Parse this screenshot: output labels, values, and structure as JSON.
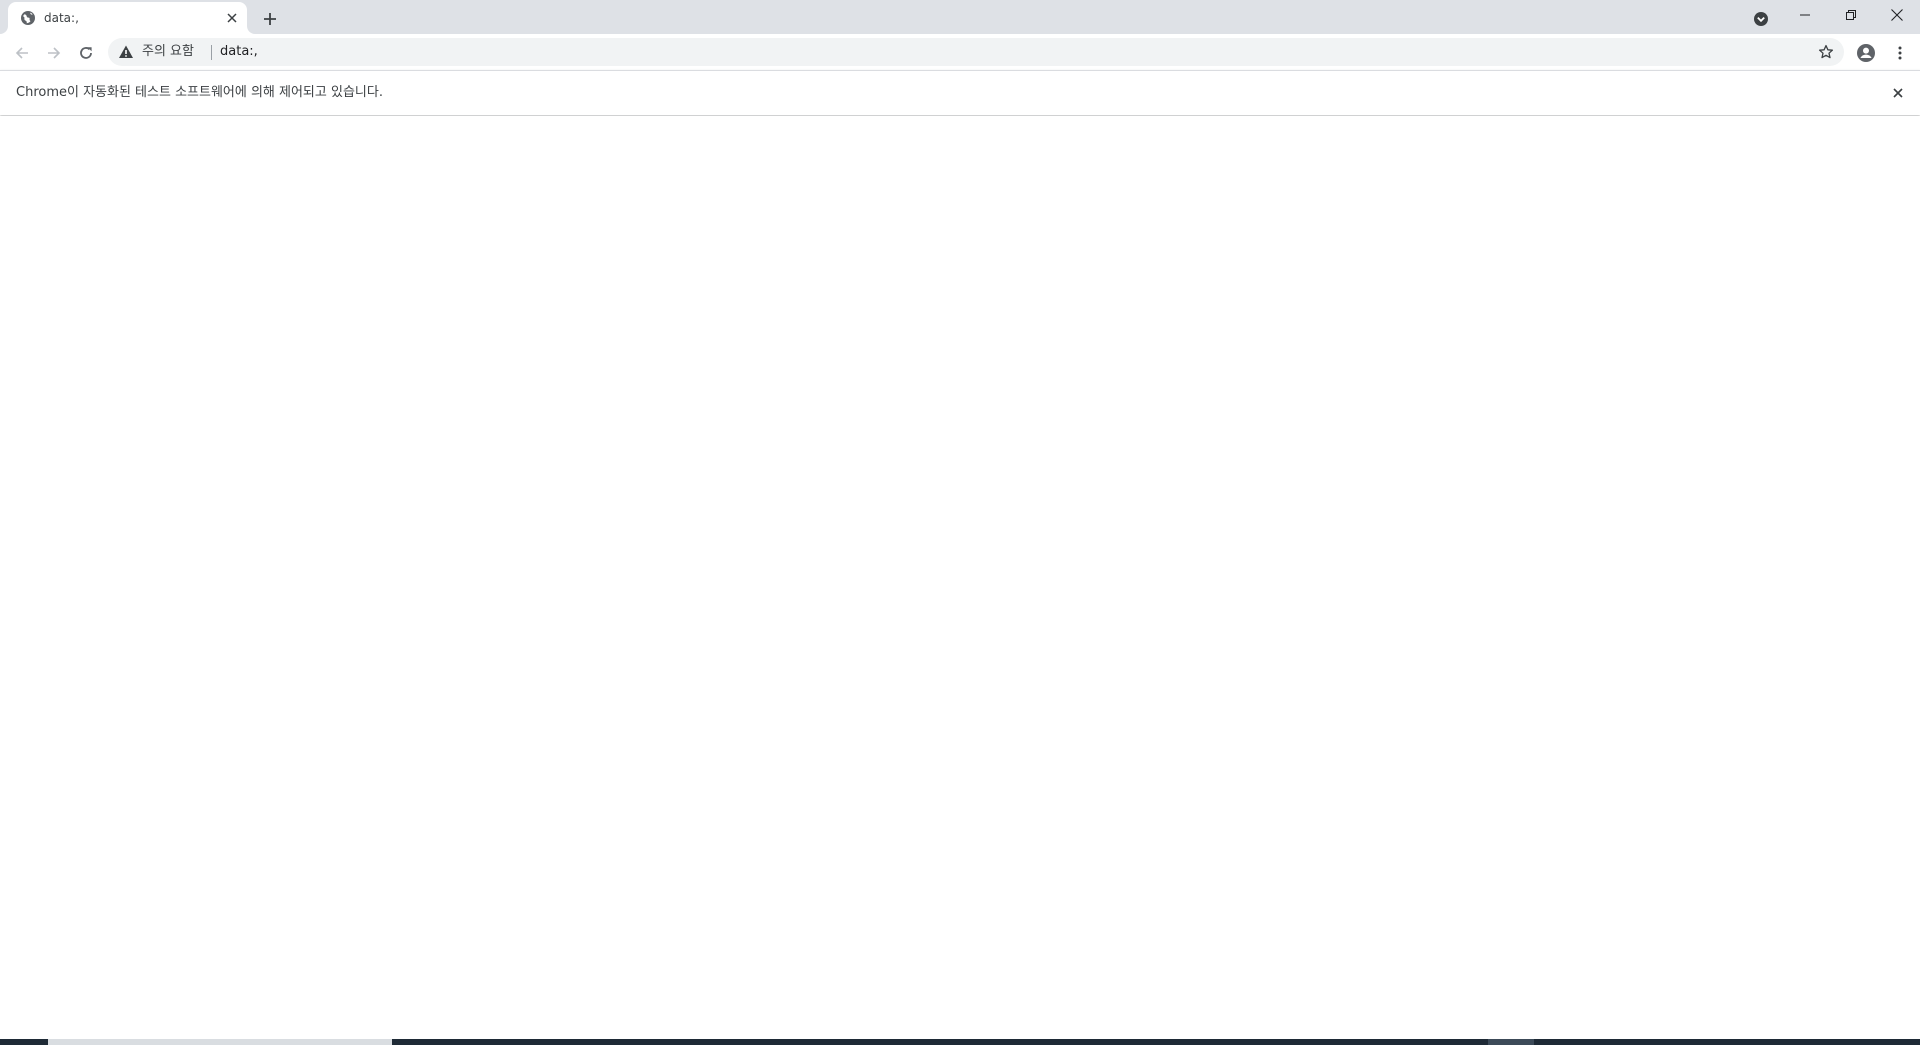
{
  "browser": {
    "tab": {
      "title": "data:,",
      "favicon": "globe-icon"
    },
    "new_tab_icon": "plus-icon",
    "window_controls": [
      "tab-search-icon",
      "minimize-icon",
      "restore-icon",
      "close-icon"
    ],
    "toolbar": {
      "back_icon": "back-arrow-icon",
      "forward_icon": "forward-arrow-icon",
      "reload_icon": "reload-icon",
      "security_icon": "warning-icon",
      "security_label": "주의 요함",
      "url": "data:,",
      "bookmark_icon": "star-icon",
      "profile_icon": "profile-icon",
      "menu_icon": "kebab-menu-icon"
    },
    "infobar": {
      "message": "Chrome이 자동화된 테스트 소프트웨어에 의해 제어되고 있습니다.",
      "close_icon": "close-icon"
    }
  },
  "colors": {
    "tabstrip_bg": "#dee1e6",
    "omnibox_bg": "#f1f3f4",
    "icon": "#5f6368",
    "disabled_icon": "#9aa0a6",
    "text": "#3c4043"
  }
}
